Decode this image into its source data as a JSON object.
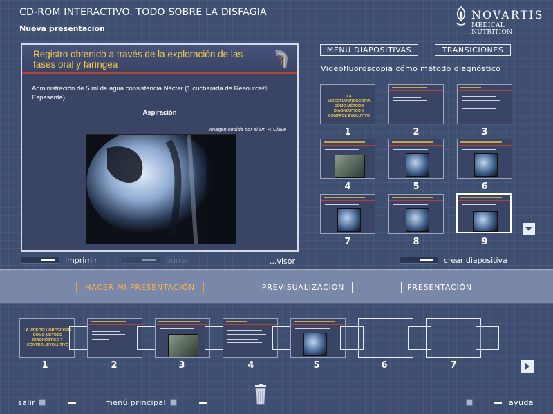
{
  "header": {
    "app_title": "CD-ROM INTERACTIVO. TODO SOBRE LA DISFAGIA",
    "presentation_name": "Nueva presentacion",
    "logo": {
      "brand": "NOVARTIS",
      "subtitle": "MEDICAL NUTRITION"
    }
  },
  "slide": {
    "title": "Registro obtenido a través de la exploración de las fases oral y faríngea",
    "body": "Administración de 5 ml de agua consistencia Néctar (1 cucharada de Resource® Espesante)",
    "heading": "Aspiración",
    "credit": "Imagen cedida por el Dr. P. Clavé",
    "icon": "throat-anatomy-icon"
  },
  "preview_controls": {
    "print_label": "imprimir",
    "delete_label": "borrar",
    "viewer_label": "...visor",
    "create_label": "crear diapositiva"
  },
  "right_pane": {
    "menu_button": "MENÚ DIAPOSITIVAS",
    "transitions_button": "TRANSICIONES",
    "section_title": "Videofluoroscopia cómo método diagnóstico",
    "cover_text": "LA VIDEOFLUOROSCOPIA CÓMO MÉTODO DIAGNÓSTICO Y CONTROL EVOLUTIVO",
    "thumbnails": [
      {
        "number": "1"
      },
      {
        "number": "2"
      },
      {
        "number": "3"
      },
      {
        "number": "4"
      },
      {
        "number": "5"
      },
      {
        "number": "6"
      },
      {
        "number": "7"
      },
      {
        "number": "8"
      },
      {
        "number": "9"
      }
    ],
    "selected": "9",
    "scroll_icon": "arrow-down-icon"
  },
  "mid_band": {
    "make_presentation": "HACER MI PRESENTACIÓN",
    "preview": "PREVISUALIZACIÓN",
    "presentation": "PRESENTACIÓN",
    "active_color": "#ffb347"
  },
  "filmstrip": {
    "cover_text": "LA VIDEOFLUOROSCOPIA CÓMO MÉTODO DIAGNÓSTICO Y CONTROL EVOLUTIVO",
    "slots": [
      {
        "number": "1"
      },
      {
        "number": "2"
      },
      {
        "number": "3"
      },
      {
        "number": "4"
      },
      {
        "number": "5"
      },
      {
        "number": "6"
      },
      {
        "number": "7"
      }
    ],
    "next_icon": "arrow-right-icon"
  },
  "footer": {
    "exit": "salir",
    "main_menu": "menú principal",
    "help": "ayuda",
    "trash_icon": "trash-icon"
  },
  "colors": {
    "background": "#3f4f72",
    "slide_title": "#f2c94c",
    "accent_red": "#b24332",
    "band": "#7987a8"
  }
}
